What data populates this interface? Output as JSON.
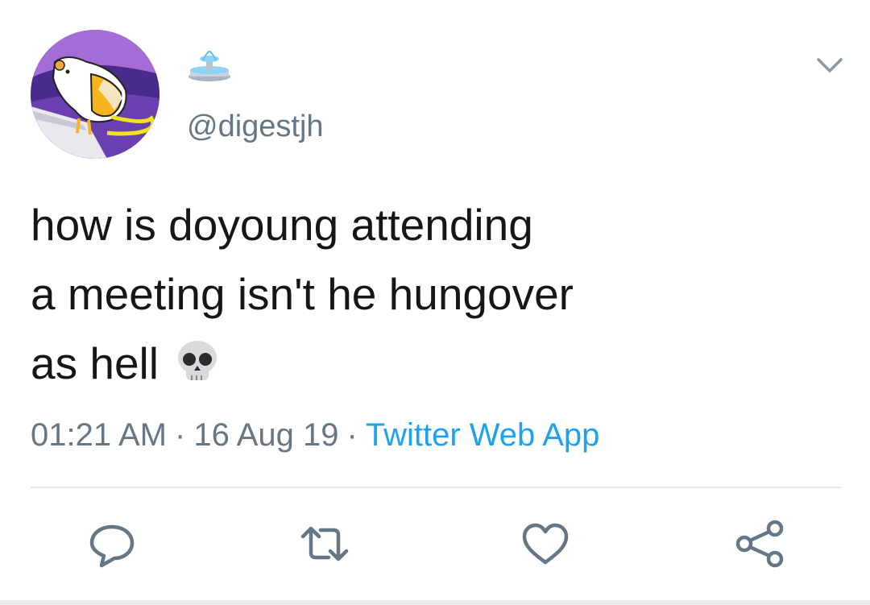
{
  "tweet": {
    "author": {
      "display_name_icon": "fountain-emoji",
      "handle": "@digestjh",
      "avatar_icon": "cartoon-rat-avatar"
    },
    "text": "how is doyoung attending\na meeting isn't he hungover\nas hell",
    "text_emoji": "skull-emoji",
    "meta": {
      "time": "01:21 AM",
      "separator": "·",
      "date": "16 Aug 19",
      "source": "Twitter Web App"
    },
    "actions": [
      "reply-icon",
      "retweet-icon",
      "like-icon",
      "share-icon"
    ],
    "menu_icon": "chevron-down-icon"
  },
  "colors": {
    "text": "#14171a",
    "muted": "#657786",
    "link": "#1da1f2",
    "divider": "#e1e8ed"
  }
}
